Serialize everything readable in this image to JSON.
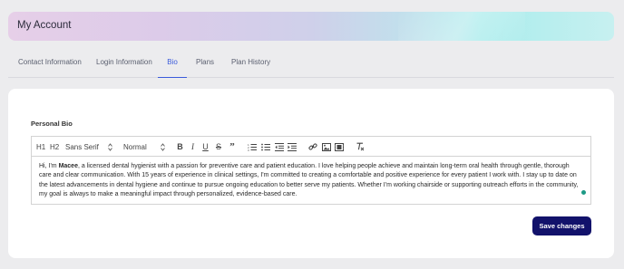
{
  "header": {
    "title": "My Account"
  },
  "tabs": [
    {
      "label": "Contact Information",
      "active": false
    },
    {
      "label": "Login Information",
      "active": false
    },
    {
      "label": "Bio",
      "active": true
    },
    {
      "label": "Plans",
      "active": false
    },
    {
      "label": "Plan History",
      "active": false
    }
  ],
  "bio": {
    "label": "Personal Bio",
    "toolbar": {
      "heading1": "H1",
      "heading2": "H2",
      "font_select": "Sans Serif",
      "size_select": "Normal",
      "icons": [
        "bold-icon",
        "italic-icon",
        "underline-icon",
        "strikethrough-icon",
        "blockquote-icon",
        "ordered-list-icon",
        "bullet-list-icon",
        "indent-decrease-icon",
        "indent-increase-icon",
        "link-icon",
        "image-icon",
        "video-icon",
        "clear-format-icon"
      ]
    },
    "text_intro": "Hi, I'm ",
    "text_name": "Macee",
    "text_body": ", a licensed dental hygienist with a passion for preventive care and patient education. I love helping people achieve and maintain long-term oral health through gentle, thorough care and clear communication. With 15 years of experience in clinical settings, I'm committed to creating a comfortable and positive experience for every patient I work with. I stay up to date on the latest advancements in dental hygiene and continue to pursue ongoing education to better serve my patients. Whether I'm working chairside or supporting outreach efforts in the community, my goal is always to make a meaningful impact through personalized, evidence-based care."
  },
  "actions": {
    "save_label": "Save changes"
  },
  "colors": {
    "accent": "#3b5bdb",
    "primary_button": "#12126b",
    "status_dot": "#1d9a86"
  }
}
